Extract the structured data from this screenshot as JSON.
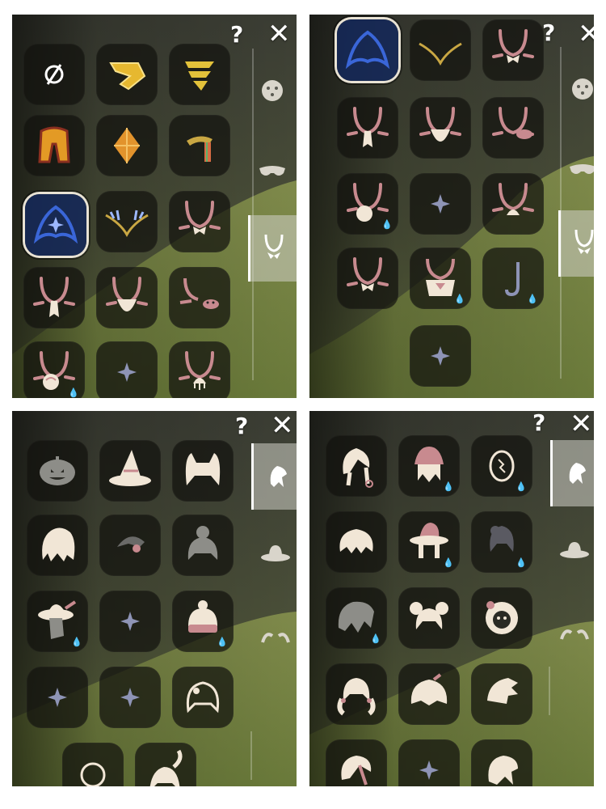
{
  "panels": [
    {
      "help": "?",
      "close": "✕"
    },
    {
      "help": "?",
      "close": "✕"
    },
    {
      "help": "?",
      "close": "✕"
    },
    {
      "help": "?",
      "close": "✕"
    }
  ],
  "colors": {
    "tile_bg": "#12120e",
    "cream": "#f1e6d6",
    "rose": "#c88a8f",
    "gold": "#e6b830",
    "blue_glow": "#3a66d8",
    "sparkle": "#8e94b6"
  },
  "icons": {
    "panel1": [
      "none-icon",
      "gold-manta-cape-icon",
      "gold-wing-icon",
      "orange-cape-icon",
      "amber-crystal-icon",
      "rainbow-horn-icon",
      "blue-flame-cape-icon",
      "antler-necklace-icon",
      "bow-necklace-icon",
      "scarf-necklace-icon",
      "beard-necklace-icon",
      "crab-necklace-icon",
      "rose-necklace-icon",
      "locked-sparkle-icon",
      "jellyfish-necklace-icon"
    ],
    "panel2": [
      "blue-flame-cape-icon",
      "antler-necklace-icon",
      "bow-necklace-icon",
      "scarf-necklace-icon",
      "beard-necklace-icon",
      "crab-necklace-icon",
      "rose-necklace-icon",
      "locked-sparkle-icon",
      "jellyfish-necklace-icon",
      "bow-necklace-icon",
      "shawl-necklace-icon",
      "hook-necklace-icon",
      "locked-sparkle-icon"
    ],
    "panel3": [
      "pumpkin-hat-icon",
      "witch-hat-icon",
      "cat-ears-hair-icon",
      "wavy-hair-icon",
      "bun-hair-icon",
      "braided-updo-hair-icon",
      "feather-hat-icon",
      "locked-sparkle-icon",
      "knit-beanie-icon",
      "locked-sparkle-icon",
      "locked-sparkle-icon",
      "bob-hair-icon",
      "halo-icon",
      "ponytail-hair-icon"
    ],
    "panel4": [
      "long-braid-hair-icon",
      "bandana-hair-icon",
      "mask-icon",
      "spiky-hair-icon",
      "flower-hat-icon",
      "bun-hair-icon",
      "messy-hair-icon",
      "space-buns-hair-icon",
      "lion-mane-icon",
      "pigtails-hair-icon",
      "bowl-hair-icon",
      "swept-hair-icon",
      "side-braid-hair-icon",
      "locked-sparkle-icon",
      "flip-hair-icon"
    ]
  },
  "sidebar": {
    "panel1": [
      "expression-icon",
      "mask-category-icon",
      "necklace-category-icon"
    ],
    "panel2": [
      "expression-icon",
      "mask-category-icon",
      "necklace-category-icon"
    ],
    "panel3": [
      "hair-category-icon",
      "hat-category-icon",
      "horn-category-icon"
    ],
    "panel4": [
      "hair-category-icon",
      "hat-category-icon",
      "horn-category-icon"
    ]
  }
}
